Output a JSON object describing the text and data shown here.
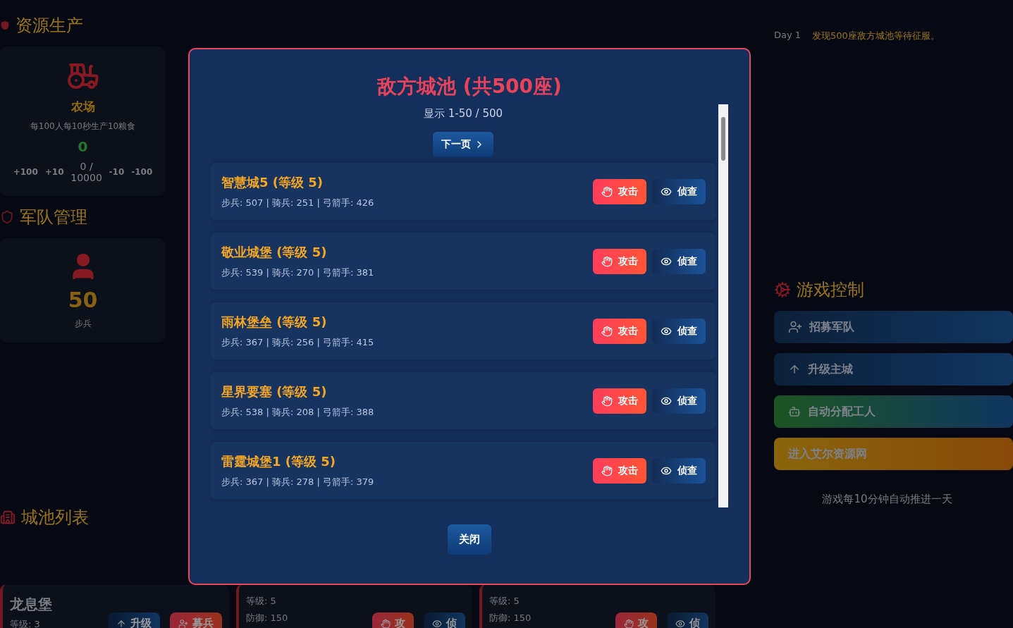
{
  "resources": {
    "title": "资源生产",
    "farm": {
      "name": "农场",
      "description": "每100人每10秒生产10粮食",
      "workers": "0",
      "adjust": [
        "+100",
        "+10",
        "-10",
        "-100"
      ],
      "capacity": "0 / 10000"
    }
  },
  "army": {
    "title": "军队管理",
    "count": "50",
    "unit": "步兵"
  },
  "log": [
    {
      "day": "Day 1",
      "text": "发现500座敌方城池等待征服。"
    }
  ],
  "controls": {
    "title": "游戏控制",
    "buttons": [
      {
        "label": "招募军队",
        "kind": "primary"
      },
      {
        "label": "升级主城",
        "kind": "primary"
      },
      {
        "label": "自动分配工人",
        "kind": "success"
      },
      {
        "label": "进入艾尔资源网",
        "kind": "warning"
      }
    ],
    "note": "游戏每10分钟自动推进一天"
  },
  "city_list": {
    "title": "城池列表",
    "own": {
      "name": "龙息堡",
      "level": "等级: 3",
      "upgrade": "升级",
      "recruit": "募兵"
    },
    "enemies": [
      {
        "level": "等级: 5",
        "defense": "防御: 150",
        "attack": "攻",
        "scout": "侦"
      },
      {
        "level": "等级: 5",
        "defense": "防御: 150",
        "attack": "攻",
        "scout": "侦"
      }
    ]
  },
  "modal": {
    "title": "敌方城池 (共500座)",
    "range": "显示 1-50 / 500",
    "next_button": "下一页",
    "cities": [
      {
        "name": "智慧城5 (等级 5)",
        "stats": "步兵: 507 | 骑兵: 251 | 弓箭手: 426",
        "attack": "攻击",
        "scout": "侦查"
      },
      {
        "name": "敬业城堡 (等级 5)",
        "stats": "步兵: 539 | 骑兵: 270 | 弓箭手: 381",
        "attack": "攻击",
        "scout": "侦查"
      },
      {
        "name": "雨林堡垒 (等级 5)",
        "stats": "步兵: 367 | 骑兵: 256 | 弓箭手: 415",
        "attack": "攻击",
        "scout": "侦查"
      },
      {
        "name": "星界要塞 (等级 5)",
        "stats": "步兵: 538 | 骑兵: 208 | 弓箭手: 388",
        "attack": "攻击",
        "scout": "侦查"
      },
      {
        "name": "雷霆城堡1 (等级 5)",
        "stats": "步兵: 367 | 骑兵: 278 | 弓箭手: 379",
        "attack": "攻击",
        "scout": "侦查"
      }
    ],
    "close_button": "关闭"
  }
}
